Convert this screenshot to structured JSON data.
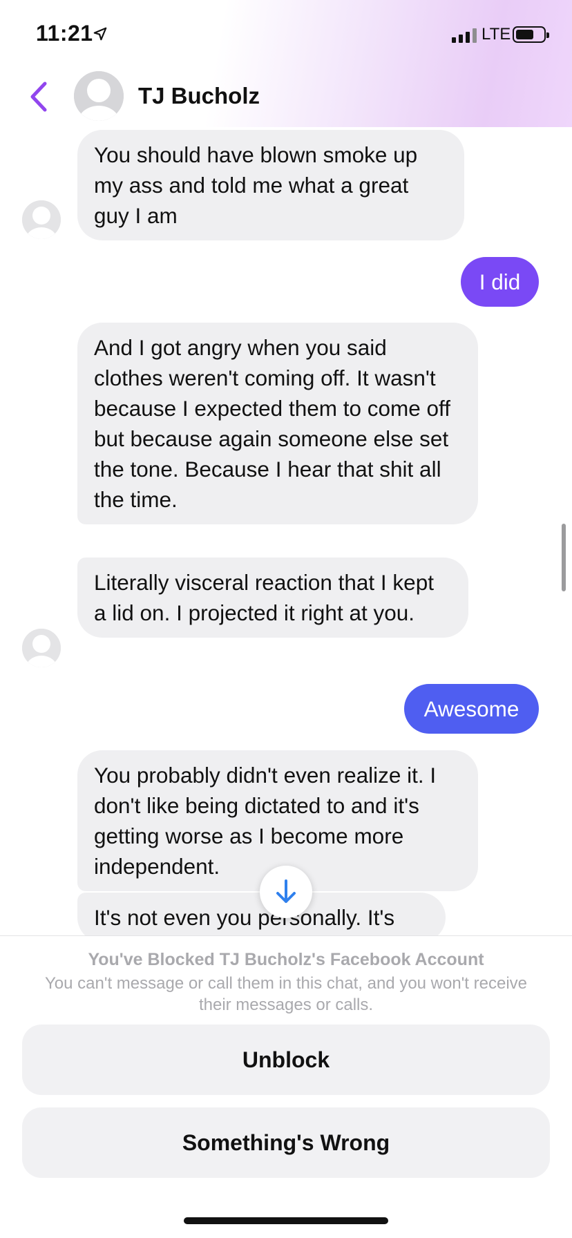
{
  "status_bar": {
    "time": "11:21",
    "network": "LTE",
    "location_icon": "location-arrow-icon",
    "battery_level": 0.65
  },
  "header": {
    "back_icon": "chevron-left-icon",
    "contact_name": "TJ Bucholz",
    "accent_color": "#9146ee"
  },
  "messages": [
    {
      "side": "incoming",
      "text": "You should have blown smoke up my ass and told me what a great guy I am"
    },
    {
      "side": "outgoing",
      "text": "I did",
      "color": "#7a49f5"
    },
    {
      "side": "incoming",
      "text": "And I got angry when you said clothes weren't coming off. It wasn't because I expected them to come off but because again someone else set the tone. Because I hear that shit all the time."
    },
    {
      "side": "incoming",
      "text": "Literally visceral reaction that I kept a lid on. I projected it right at you."
    },
    {
      "side": "outgoing",
      "text": "Awesome",
      "color": "#4f5ef1"
    },
    {
      "side": "incoming",
      "text": "You probably didn't even realize it. I don't like being dictated to and it's getting worse as I become more independent."
    },
    {
      "side": "incoming",
      "text": "It's not even you personally. It's"
    }
  ],
  "scroll_down_icon": "arrow-down-icon",
  "blocked": {
    "title": "You've Blocked TJ Bucholz's Facebook Account",
    "description": "You can't message or call them in this chat, and you won't receive their messages or calls.",
    "unblock_label": "Unblock",
    "wrong_label": "Something's Wrong"
  }
}
